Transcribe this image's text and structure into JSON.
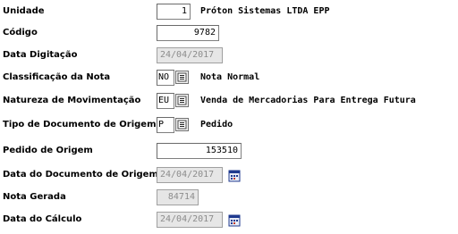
{
  "fields": {
    "unidade": {
      "label": "Unidade",
      "value": "1",
      "description": "Próton Sistemas LTDA EPP"
    },
    "codigo": {
      "label": "Código",
      "value": "9782"
    },
    "data_digitacao": {
      "label": "Data Digitação",
      "value": "24/04/2017"
    },
    "classificacao": {
      "label": "Classificação da Nota",
      "value": "NO",
      "description": "Nota Normal"
    },
    "natureza": {
      "label": "Natureza de Movimentação",
      "value": "EU",
      "description": "Venda de Mercadorias Para Entrega Futura"
    },
    "tipo_documento": {
      "label": "Tipo de Documento de Origem",
      "value": "P",
      "description": "Pedido"
    },
    "pedido_origem": {
      "label": "Pedido de Origem",
      "value": "153510"
    },
    "data_documento_origem": {
      "label": "Data do Documento de Origem",
      "value": "24/04/2017"
    },
    "nota_gerada": {
      "label": "Nota Gerada",
      "value": "84714"
    },
    "data_calculo": {
      "label": "Data do Cálculo",
      "value": "24/04/2017"
    }
  },
  "icons": {
    "lookup": "list-lookup-icon",
    "calendar": "calendar-icon"
  },
  "colors": {
    "background": "#ffffff",
    "disabled_field": "#e6e6e6",
    "disabled_text": "#8c8c8c",
    "calendar_accent": "#1f3a8f"
  }
}
